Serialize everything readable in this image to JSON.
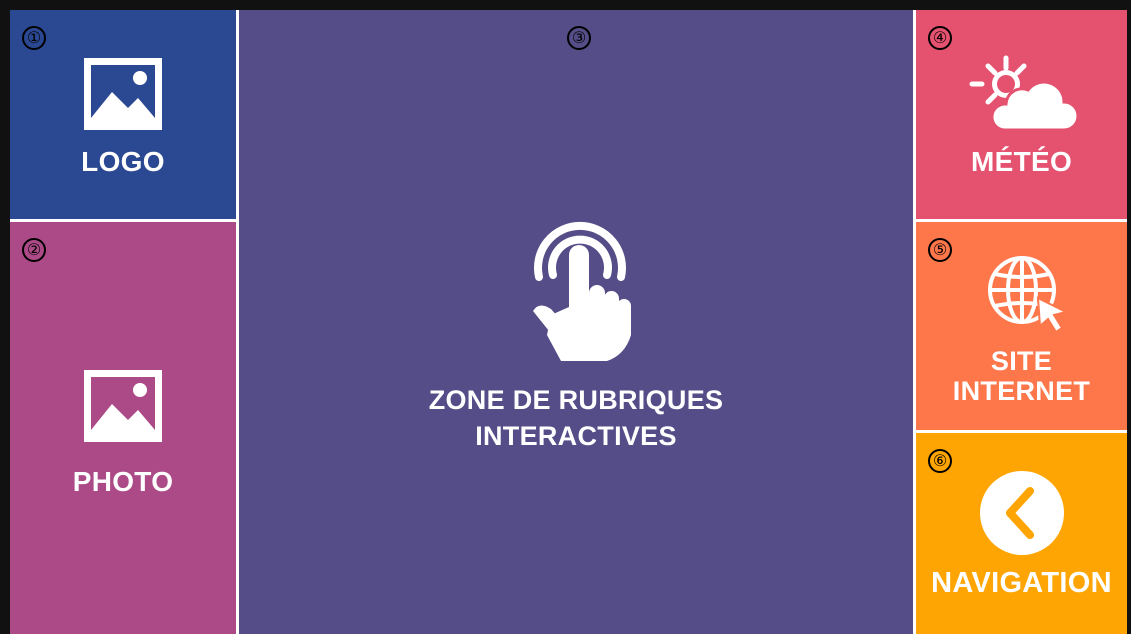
{
  "tiles": {
    "logo": {
      "number": "①",
      "label": "LOGO",
      "color": "#2b4892",
      "icon": "image-icon"
    },
    "photo": {
      "number": "②",
      "label": "PHOTO",
      "color": "#ab4a86",
      "icon": "image-icon"
    },
    "zone": {
      "number": "③",
      "label_line1": "ZONE DE RUBRIQUES",
      "label_line2": "INTERACTIVES",
      "color": "#554d88",
      "icon": "touch-hand-icon"
    },
    "meteo": {
      "number": "④",
      "label": "MÉTÉO",
      "color": "#e4526f",
      "icon": "sun-cloud-icon"
    },
    "site": {
      "number": "⑤",
      "label_line1": "SITE",
      "label_line2": "INTERNET",
      "color": "#fe774b",
      "icon": "globe-cursor-icon"
    },
    "navigation": {
      "number": "⑥",
      "label": "NAVIGATION",
      "color": "#fea503",
      "icon": "chevron-left-icon"
    }
  }
}
